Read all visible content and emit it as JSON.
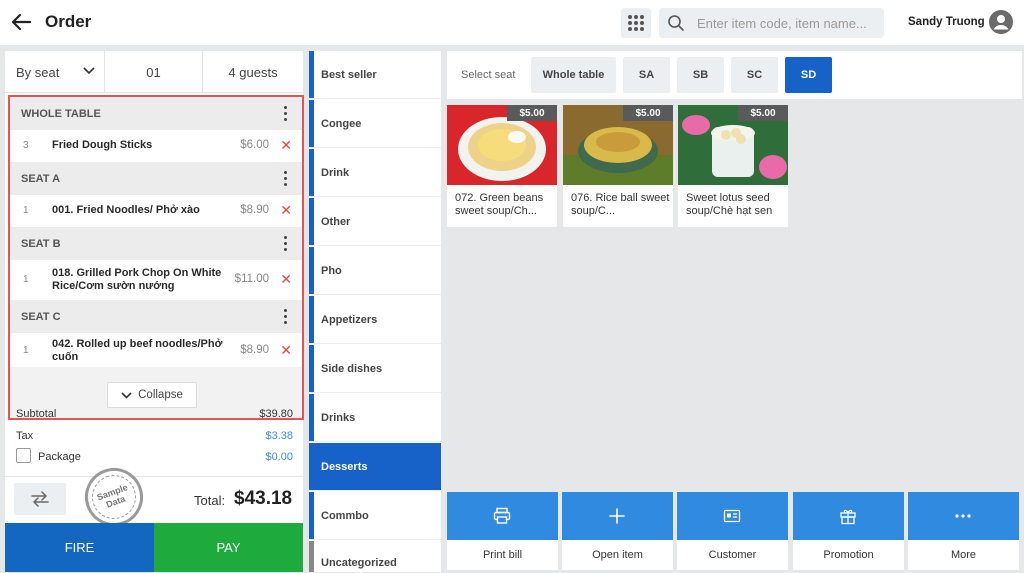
{
  "header": {
    "title": "Order",
    "search_placeholder": "Enter item code, item name...",
    "user_name": "Sandy Truong"
  },
  "order_panel": {
    "seat_mode": "By seat",
    "table_no": "01",
    "guests": "4 guests",
    "groups": [
      {
        "label": "WHOLE TABLE",
        "items": [
          {
            "qty": "3",
            "name": "Fried Dough Sticks",
            "price": "$6.00"
          }
        ]
      },
      {
        "label": "SEAT A",
        "items": [
          {
            "qty": "1",
            "name": "001. Fried Noodles/ Phở xào",
            "price": "$8.90"
          }
        ]
      },
      {
        "label": "SEAT B",
        "items": [
          {
            "qty": "1",
            "name": "018. Grilled Pork Chop On White Rice/Cơm sườn nướng",
            "price": "$11.00"
          }
        ]
      },
      {
        "label": "SEAT C",
        "items": [
          {
            "qty": "1",
            "name": "042. Rolled up beef noodles/Phở cuốn",
            "price": "$8.90"
          }
        ]
      }
    ],
    "collapse_label": "Collapse",
    "subtotal_label": "Subtotal",
    "subtotal": "$39.80",
    "tax_label": "Tax",
    "tax": "$3.38",
    "package_label": "Package",
    "package": "$0.00",
    "stamp_text": "Sample Data",
    "total_label": "Total:",
    "total": "$43.18",
    "fire_label": "FIRE",
    "pay_label": "PAY"
  },
  "categories": [
    {
      "label": "Best seller",
      "color": "#1762c8",
      "active": false
    },
    {
      "label": "Congee",
      "color": "#1762c8",
      "active": false
    },
    {
      "label": "Drink",
      "color": "#1762c8",
      "active": false
    },
    {
      "label": "Other",
      "color": "#1762c8",
      "active": false
    },
    {
      "label": "Pho",
      "color": "#1762c8",
      "active": false
    },
    {
      "label": "Appetizers",
      "color": "#1762c8",
      "active": false
    },
    {
      "label": "Side dishes",
      "color": "#1762c8",
      "active": false
    },
    {
      "label": "Drinks",
      "color": "#1762c8",
      "active": false
    },
    {
      "label": "Desserts",
      "color": "#1762c8",
      "active": true
    },
    {
      "label": "Commbo",
      "color": "#1762c8",
      "active": false
    },
    {
      "label": "Uncategorized",
      "color": "#888888",
      "active": false
    }
  ],
  "seat_selector": {
    "label": "Select seat",
    "options": [
      "Whole table",
      "SA",
      "SB",
      "SC",
      "SD"
    ],
    "selected": "SD"
  },
  "products": [
    {
      "name": "072. Green beans sweet soup/Ch...",
      "price": "$5.00"
    },
    {
      "name": "076. Rice ball sweet soup/C...",
      "price": "$5.00"
    },
    {
      "name": "Sweet lotus seed soup/Chè hạt sen",
      "price": "$5.00"
    }
  ],
  "actions": [
    {
      "label": "Print bill",
      "icon": "printer-icon"
    },
    {
      "label": "Open item",
      "icon": "plus-icon"
    },
    {
      "label": "Customer",
      "icon": "id-card-icon"
    },
    {
      "label": "Promotion",
      "icon": "gift-icon"
    },
    {
      "label": "More",
      "icon": "more-dots-icon"
    }
  ],
  "colors": {
    "accent": "#1762c8",
    "action_blue": "#2f8ae0",
    "pay_green": "#1eaa3c",
    "delete_red": "#e24848",
    "tax_blue": "#3a8ee6",
    "highlight_border": "#e2545a"
  }
}
